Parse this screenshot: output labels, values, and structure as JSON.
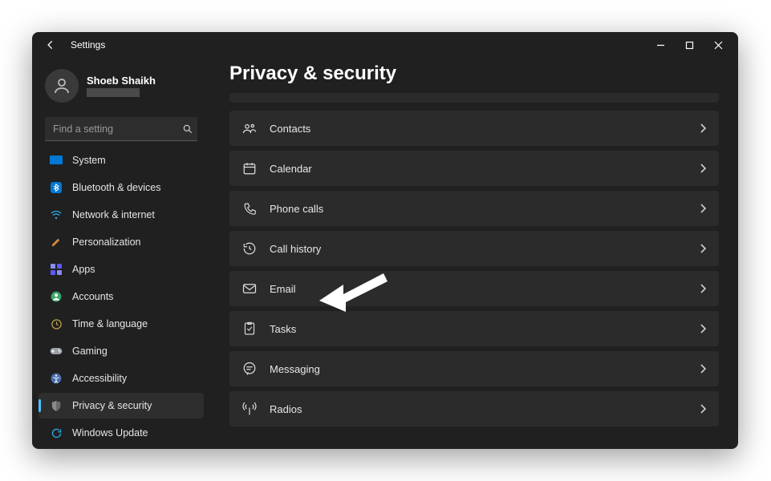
{
  "window": {
    "title": "Settings"
  },
  "user": {
    "name": "Shoeb Shaikh"
  },
  "search": {
    "placeholder": "Find a setting"
  },
  "sidebar": {
    "items": [
      {
        "label": "System"
      },
      {
        "label": "Bluetooth & devices"
      },
      {
        "label": "Network & internet"
      },
      {
        "label": "Personalization"
      },
      {
        "label": "Apps"
      },
      {
        "label": "Accounts"
      },
      {
        "label": "Time & language"
      },
      {
        "label": "Gaming"
      },
      {
        "label": "Accessibility"
      },
      {
        "label": "Privacy & security"
      },
      {
        "label": "Windows Update"
      }
    ]
  },
  "main": {
    "title": "Privacy & security",
    "rows": [
      {
        "label": "Contacts"
      },
      {
        "label": "Calendar"
      },
      {
        "label": "Phone calls"
      },
      {
        "label": "Call history"
      },
      {
        "label": "Email"
      },
      {
        "label": "Tasks"
      },
      {
        "label": "Messaging"
      },
      {
        "label": "Radios"
      }
    ]
  }
}
